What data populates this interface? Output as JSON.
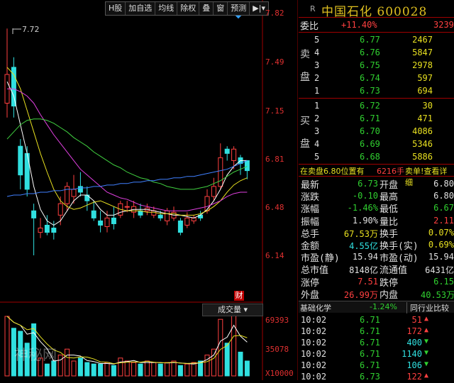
{
  "toolbar": {
    "items": [
      "H股",
      "加自选",
      "均线",
      "除权",
      "叠",
      "窗",
      "预测",
      "▶|▾"
    ]
  },
  "axis": {
    "prices": [
      "7.82",
      "7.49",
      "7.15",
      "6.81",
      "6.48",
      "6.14"
    ],
    "high_marker": "7.72"
  },
  "volume_panel": {
    "label": "成交量",
    "cai_label": "财",
    "ticks": [
      "69393",
      "35078",
      "X10000"
    ]
  },
  "watermark": "神秘网",
  "header": {
    "r_label": "R",
    "name": "中国石化",
    "code": "600028"
  },
  "weibi": {
    "label": "委比",
    "value": "+11.40%",
    "num": "3239"
  },
  "sell_label": [
    "卖",
    "盘"
  ],
  "buy_label": [
    "买",
    "盘"
  ],
  "sell": [
    {
      "lvl": "5",
      "price": "6.77",
      "vol": "2467"
    },
    {
      "lvl": "4",
      "price": "6.76",
      "vol": "5847"
    },
    {
      "lvl": "3",
      "price": "6.75",
      "vol": "2978"
    },
    {
      "lvl": "2",
      "price": "6.74",
      "vol": "597"
    },
    {
      "lvl": "1",
      "price": "6.73",
      "vol": "694"
    }
  ],
  "buy": [
    {
      "lvl": "1",
      "price": "6.72",
      "vol": "30"
    },
    {
      "lvl": "2",
      "price": "6.71",
      "vol": "471"
    },
    {
      "lvl": "3",
      "price": "6.70",
      "vol": "4086"
    },
    {
      "lvl": "4",
      "price": "6.69",
      "vol": "5346"
    },
    {
      "lvl": "5",
      "price": "6.68",
      "vol": "5886"
    }
  ],
  "info_bar": {
    "left": "在卖盘6.80位置有",
    "mid": "6216手",
    "right": "卖单!查看详细"
  },
  "stats": [
    {
      "k1": "最新",
      "v1": "6.73",
      "c1": "green",
      "k2": "开盘",
      "v2": "6.80",
      "c2": "white"
    },
    {
      "k1": "涨跌",
      "v1": "-0.10",
      "c1": "green",
      "k2": "最高",
      "v2": "6.80",
      "c2": "white"
    },
    {
      "k1": "涨幅",
      "v1": "-1.46%",
      "c1": "green",
      "k2": "最低",
      "v2": "6.67",
      "c2": "green"
    },
    {
      "k1": "振幅",
      "v1": "1.90%",
      "c1": "white",
      "k2": "量比",
      "v2": "2.11",
      "c2": "red"
    },
    {
      "k1": "总手",
      "v1": "67.53万",
      "c1": "yellow",
      "k2": "换手",
      "v2": "0.07%",
      "c2": "yellow"
    },
    {
      "k1": "金额",
      "v1": "4.55亿",
      "c1": "cyan",
      "k2": "换手(实)",
      "v2": "0.69%",
      "c2": "yellow"
    },
    {
      "k1": "市盈(静)",
      "v1": "15.94",
      "c1": "white",
      "k2": "市盈(动)",
      "v2": "15.94",
      "c2": "white"
    },
    {
      "k1": "总市值",
      "v1": "8148亿",
      "c1": "white",
      "k2": "流通值",
      "v2": "6431亿",
      "c2": "white"
    },
    {
      "k1": "涨停",
      "v1": "7.51",
      "c1": "red",
      "k2": "跌停",
      "v2": "6.15",
      "c2": "green"
    },
    {
      "k1": "外盘",
      "v1": "26.99万",
      "c1": "red",
      "k2": "内盘",
      "v2": "40.53万",
      "c2": "green"
    }
  ],
  "section": {
    "left": "基础化学",
    "mid": "-1.24%",
    "right": "同行业比较"
  },
  "ticks": [
    {
      "t": "10:02",
      "p": "6.71",
      "v": "51",
      "dir": "up"
    },
    {
      "t": "10:02",
      "p": "6.71",
      "v": "172",
      "dir": "up"
    },
    {
      "t": "10:02",
      "p": "6.71",
      "v": "400",
      "dir": "down"
    },
    {
      "t": "10:02",
      "p": "6.71",
      "v": "1140",
      "dir": "down"
    },
    {
      "t": "10:02",
      "p": "6.71",
      "v": "106",
      "dir": "down"
    },
    {
      "t": "10:02",
      "p": "6.73",
      "v": "122",
      "dir": "up"
    }
  ],
  "colors": {
    "up": "#ff4040",
    "down": "#30e0e0",
    "ma5": "#ffffff",
    "ma10": "#e8e020",
    "ma20": "#e040e0",
    "ma30": "#40d040",
    "ma60": "#4080ff",
    "grid": "#800000"
  }
}
